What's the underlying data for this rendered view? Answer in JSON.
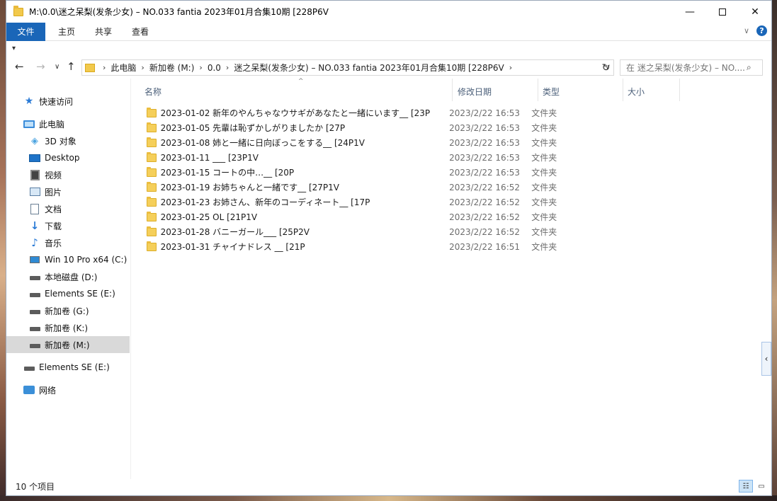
{
  "window": {
    "title": "M:\\0.0\\迷之呆梨(发条少女) – NO.033 fantia 2023年01月合集10期 [228P6V",
    "minimize": "—",
    "maximize": "",
    "close": "✕"
  },
  "ribbon": {
    "tabs": [
      "文件",
      "主页",
      "共享",
      "查看"
    ],
    "expand": "∨",
    "help": "?"
  },
  "quick_access": {
    "customize": "▾"
  },
  "nav": {
    "back": "←",
    "forward": "→",
    "recent": "∨",
    "up": "↑",
    "breadcrumbs": [
      "此电脑",
      "新加卷 (M:)",
      "0.0",
      "迷之呆梨(发条少女) – NO.033 fantia 2023年01月合集10期 [228P6V"
    ],
    "sep": "›",
    "dropdown": "∨",
    "refresh": "↻"
  },
  "search": {
    "placeholder": "在 迷之呆梨(发条少女) – NO....",
    "icon": "⌕"
  },
  "sidebar": {
    "items": [
      {
        "label": "快速访问",
        "icon": "star-icon"
      },
      {
        "label": "此电脑",
        "icon": "computer-icon"
      },
      {
        "label": "3D 对象",
        "icon": "cube-icon"
      },
      {
        "label": "Desktop",
        "icon": "desktop-icon"
      },
      {
        "label": "视频",
        "icon": "video-icon"
      },
      {
        "label": "图片",
        "icon": "pictures-icon"
      },
      {
        "label": "文档",
        "icon": "documents-icon"
      },
      {
        "label": "下载",
        "icon": "download-icon"
      },
      {
        "label": "音乐",
        "icon": "music-icon"
      },
      {
        "label": "Win 10 Pro x64 (C:)",
        "icon": "windows-drive-icon"
      },
      {
        "label": "本地磁盘 (D:)",
        "icon": "drive-icon"
      },
      {
        "label": "Elements SE (E:)",
        "icon": "drive-icon"
      },
      {
        "label": "新加卷 (G:)",
        "icon": "drive-icon"
      },
      {
        "label": "新加卷 (K:)",
        "icon": "drive-icon"
      },
      {
        "label": "新加卷 (M:)",
        "icon": "drive-icon",
        "selected": true
      },
      {
        "label": "Elements SE (E:)",
        "icon": "drive-icon"
      },
      {
        "label": "网络",
        "icon": "network-icon"
      }
    ]
  },
  "columns": {
    "name": "名称",
    "modified": "修改日期",
    "type": "类型",
    "size": "大小",
    "sort_indicator": "^"
  },
  "files": [
    {
      "name": "2023-01-02 新年のやんちゃなウサギがあなたと一緒にいます__ [23P",
      "modified": "2023/2/22 16:53",
      "type": "文件夹"
    },
    {
      "name": "2023-01-05 先輩は恥ずかしがりましたか [27P",
      "modified": "2023/2/22 16:53",
      "type": "文件夹"
    },
    {
      "name": "2023-01-08 姉と一緒に日向ぼっこをする__ [24P1V",
      "modified": "2023/2/22 16:53",
      "type": "文件夹"
    },
    {
      "name": "2023-01-11 ___ [23P1V",
      "modified": "2023/2/22 16:53",
      "type": "文件夹"
    },
    {
      "name": "2023-01-15 コートの中…__ [20P",
      "modified": "2023/2/22 16:53",
      "type": "文件夹"
    },
    {
      "name": "2023-01-19 お姉ちゃんと一緒です__ [27P1V",
      "modified": "2023/2/22 16:52",
      "type": "文件夹"
    },
    {
      "name": "2023-01-23 お姉さん、新年のコーディネート__ [17P",
      "modified": "2023/2/22 16:52",
      "type": "文件夹"
    },
    {
      "name": "2023-01-25 OL [21P1V",
      "modified": "2023/2/22 16:52",
      "type": "文件夹"
    },
    {
      "name": "2023-01-28 バニーガール___ [25P2V",
      "modified": "2023/2/22 16:52",
      "type": "文件夹"
    },
    {
      "name": "2023-01-31 チャイナドレス __ [21P",
      "modified": "2023/2/22 16:51",
      "type": "文件夹"
    }
  ],
  "side_panel_toggle": "‹",
  "status": {
    "count": "10 个项目"
  },
  "view": {
    "details": "☷",
    "large_icons": "▭"
  }
}
